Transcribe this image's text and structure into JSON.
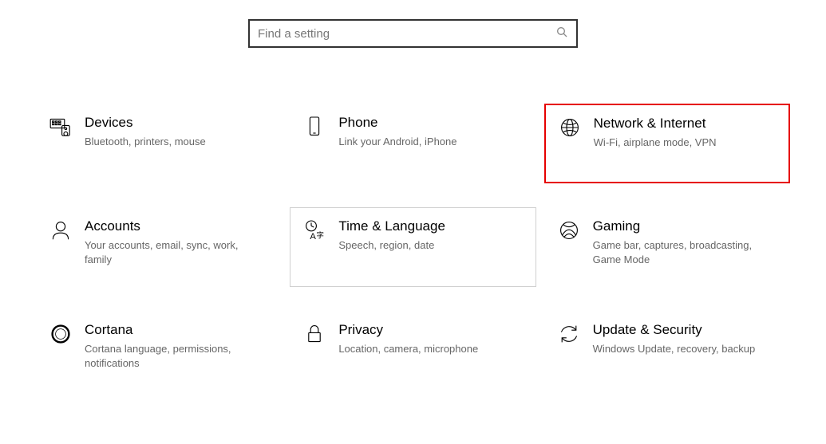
{
  "search": {
    "placeholder": "Find a setting"
  },
  "tiles": {
    "devices": {
      "title": "Devices",
      "sub": "Bluetooth, printers, mouse"
    },
    "phone": {
      "title": "Phone",
      "sub": "Link your Android, iPhone"
    },
    "network": {
      "title": "Network & Internet",
      "sub": "Wi-Fi, airplane mode, VPN"
    },
    "accounts": {
      "title": "Accounts",
      "sub": "Your accounts, email, sync, work, family"
    },
    "time": {
      "title": "Time & Language",
      "sub": "Speech, region, date"
    },
    "gaming": {
      "title": "Gaming",
      "sub": "Game bar, captures, broadcasting, Game Mode"
    },
    "cortana": {
      "title": "Cortana",
      "sub": "Cortana language, permissions, notifications"
    },
    "privacy": {
      "title": "Privacy",
      "sub": "Location, camera, microphone"
    },
    "update": {
      "title": "Update & Security",
      "sub": "Windows Update, recovery, backup"
    }
  }
}
